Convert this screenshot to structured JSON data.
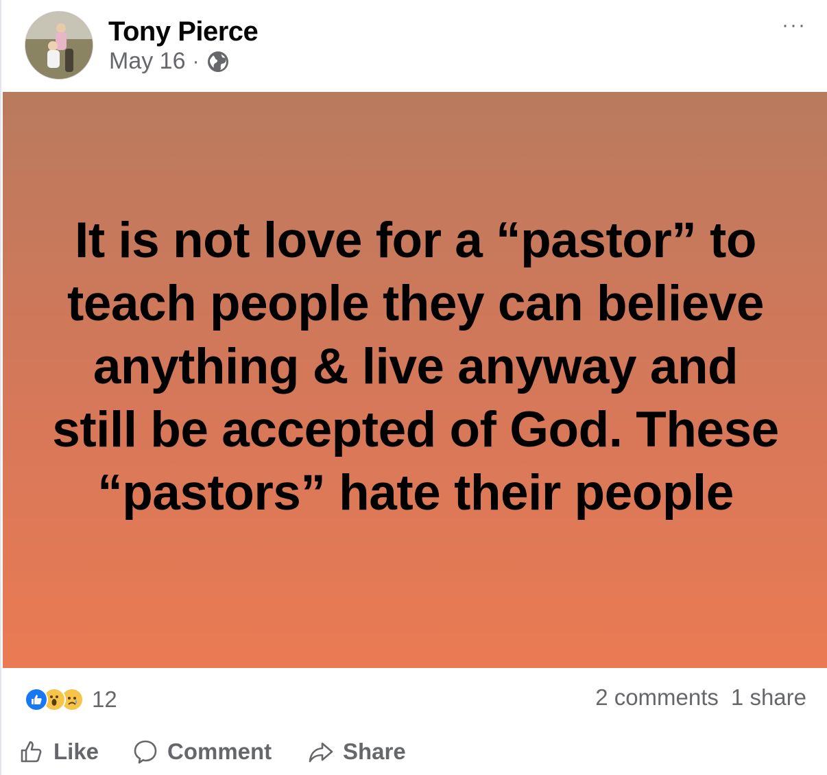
{
  "post": {
    "author": "Tony Pierce",
    "date": "May 16",
    "separator": "·",
    "privacy_icon": "globe-icon",
    "more_label": "···",
    "background_colors": [
      "#b97a5e",
      "#ea7a54"
    ],
    "text": "It is not love for a “pastor” to teach people they can believe anything & live anyway and still be accepted of God. These “pastors” hate their people"
  },
  "stats": {
    "reactions": [
      "like",
      "wow",
      "sad"
    ],
    "reaction_count": "12",
    "comments": "2 comments",
    "shares": "1 share"
  },
  "actions": {
    "like": "Like",
    "comment": "Comment",
    "share": "Share"
  }
}
